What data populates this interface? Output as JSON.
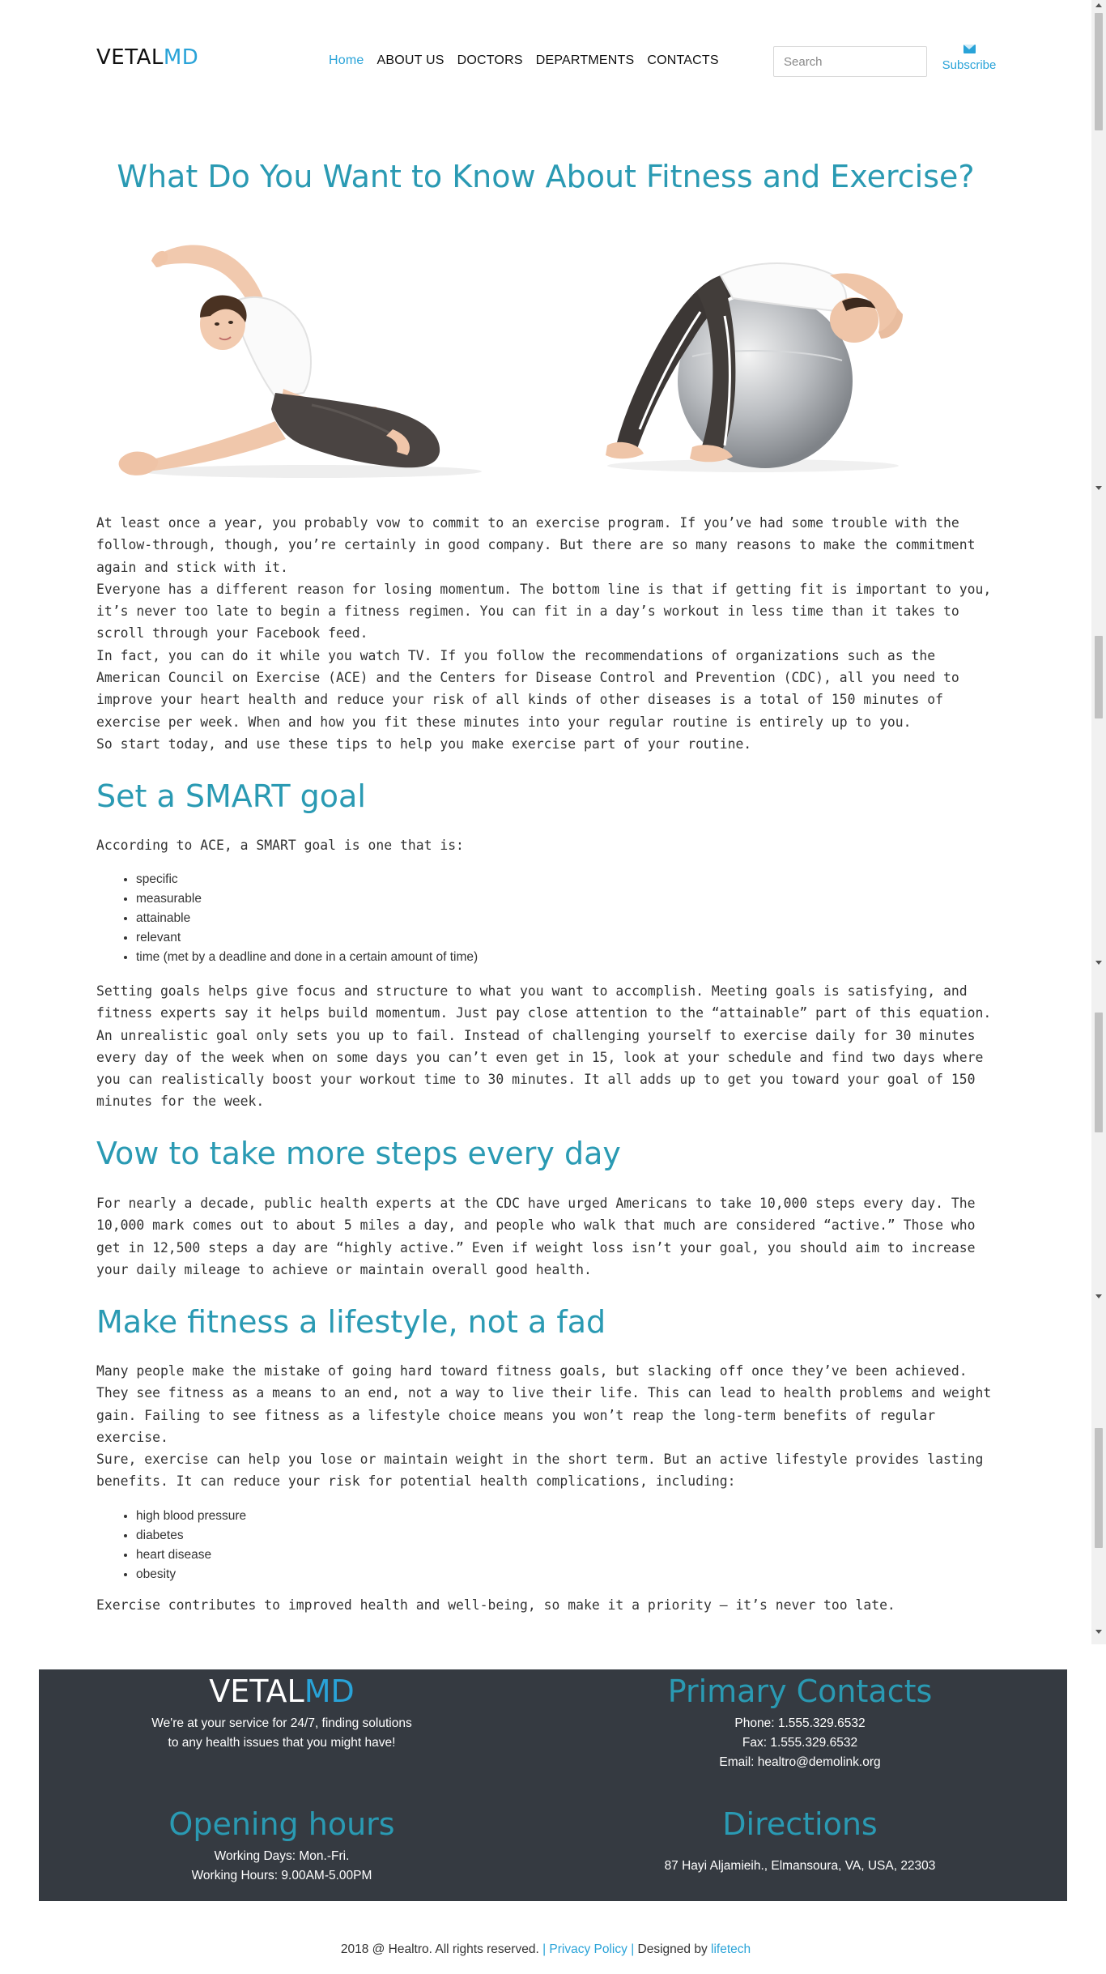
{
  "header": {
    "logo_part1": "VETAL",
    "logo_part2": "MD",
    "nav": [
      "Home",
      "ABOUT US",
      "DOCTORS",
      "DEPARTMENTS",
      "CONTACTS"
    ],
    "search_placeholder": "Search",
    "subscribe_label": "Subscribe",
    "subscribe_icon": "envelope-icon"
  },
  "article": {
    "title": "What Do You Want to Know About Fitness and Exercise?",
    "intro": [
      "At least once a year, you probably vow to commit to an exercise program. If you’ve had some trouble with the follow-through, though, you’re certainly in good company. But there are so many reasons to make the commitment again and stick with it.",
      "Everyone has a different reason for losing momentum. The bottom line is that if getting fit is important to you, it’s never too late to begin a fitness regimen. You can fit in a day’s workout in less time than it takes to scroll through your Facebook feed.",
      "In fact, you can do it while you watch TV. If you follow the recommendations of organizations such as the American Council on Exercise (ACE) and the Centers for Disease Control and Prevention (CDC), all you need to improve your heart health and reduce your risk of all kinds of other diseases is a total of 150 minutes of exercise per week. When and how you fit these minutes into your regular routine is entirely up to you.",
      "So start today, and use these tips to help you make exercise part of your routine."
    ],
    "s1_heading": "Set a SMART goal",
    "s1_lead": "According to ACE, a SMART goal is one that is:",
    "s1_list": [
      "specific",
      "measurable",
      "attainable",
      "relevant",
      "time (met by a deadline and done in a certain amount of time)"
    ],
    "s1_body": "Setting goals helps give focus and structure to what you want to accomplish. Meeting goals is satisfying, and fitness experts say it helps build momentum. Just pay close attention to the “attainable” part of this equation. An unrealistic goal only sets you up to fail. Instead of challenging yourself to exercise daily for 30 minutes every day of the week when on some days you can’t even get in 15, look at your schedule and find two days where you can realistically boost your workout time to 30 minutes. It all adds up to get you toward your goal of 150 minutes for the week.",
    "s2_heading": "Vow to take more steps every day",
    "s2_body": "For nearly a decade, public health experts at the CDC have urged Americans to take 10,000 steps every day. The 10,000 mark comes out to about 5 miles a day, and people who walk that much are considered “active.” Those who get in 12,500 steps a day are “highly active.” Even if weight loss isn’t your goal, you should aim to increase your daily mileage to achieve or maintain overall good health.",
    "s3_heading": "Make fitness a lifestyle, not a fad",
    "s3_body1": "Many people make the mistake of going hard toward fitness goals, but slacking off once they’ve been achieved. They see fitness as a means to an end, not a way to live their life. This can lead to health problems and weight gain. Failing to see fitness as a lifestyle choice means you won’t reap the long-term benefits of regular exercise.",
    "s3_body2": "Sure, exercise can help you lose or maintain weight in the short term. But an active lifestyle provides lasting benefits. It can reduce your risk for potential health complications, including:",
    "s3_list": [
      "high blood pressure",
      "diabetes",
      "heart disease",
      "obesity"
    ],
    "s3_closing": "Exercise contributes to improved health and well-being, so make it a priority — it’s never too late."
  },
  "footer": {
    "logo_part1": "VETAL",
    "logo_part2": "MD",
    "tagline_line1": "We're at your service for 24/7, finding solutions",
    "tagline_line2": "to any health issues that you might have!",
    "contacts_heading": "Primary Contacts",
    "phone": "Phone: 1.555.329.6532",
    "fax": "Fax: 1.555.329.6532",
    "email": "Email: healtro@demolink.org",
    "hours_heading": "Opening hours",
    "working_days": "Working Days: Mon.-Fri.",
    "working_hours": "Working Hours: 9.00AM-5.00PM",
    "directions_heading": "Directions",
    "address": "87 Hayi Aljamieih., Elmansoura, VA, USA, 22303",
    "copyright_text": "2018 @ Healtro. All rights reserved.",
    "separator": "|",
    "privacy_label": "Privacy Policy",
    "designed_by_label": "Designed by",
    "designer_name": "lifetech"
  },
  "colors": {
    "accent": "#29a3d8",
    "heading": "#2a9ab3",
    "footer_bg": "#353a41"
  }
}
